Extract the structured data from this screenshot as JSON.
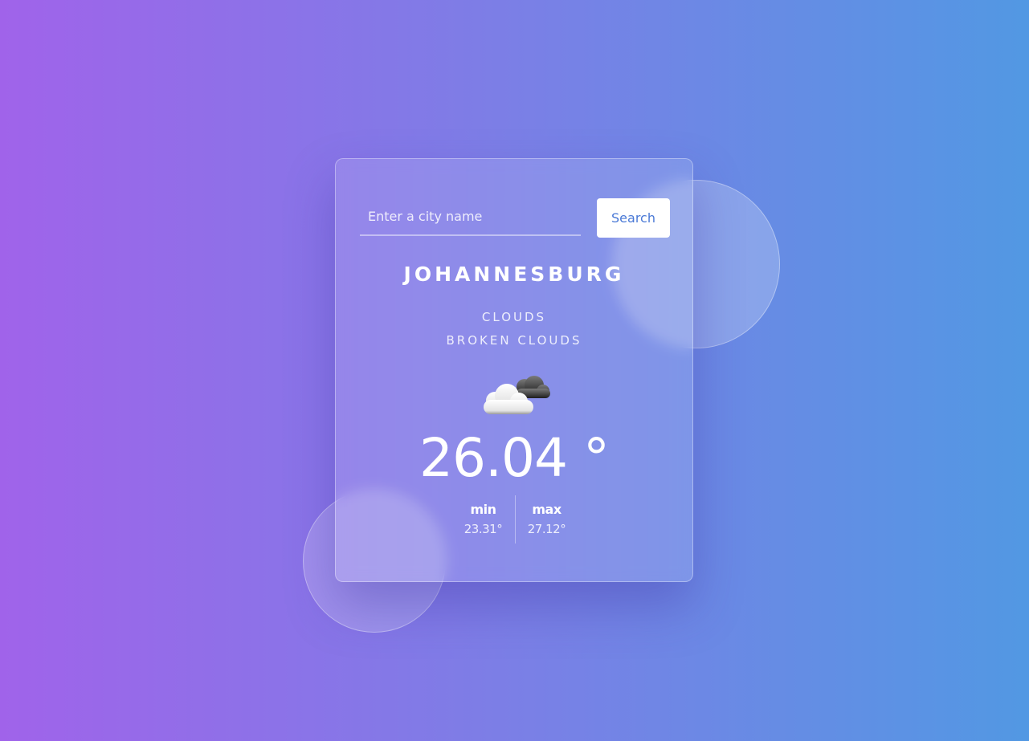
{
  "search": {
    "placeholder": "Enter a city name",
    "value": "",
    "button_label": "Search"
  },
  "weather": {
    "city": "JOHANNESBURG",
    "condition": "CLOUDS",
    "description": "BROKEN CLOUDS",
    "icon": "broken-clouds-icon",
    "temperature": "26.04 °",
    "min_label": "min",
    "min_value": "23.31°",
    "max_label": "max",
    "max_value": "27.12°"
  },
  "colors": {
    "background_start": "#a063ea",
    "background_end": "#5298e3",
    "button_text": "#4a79d6"
  }
}
